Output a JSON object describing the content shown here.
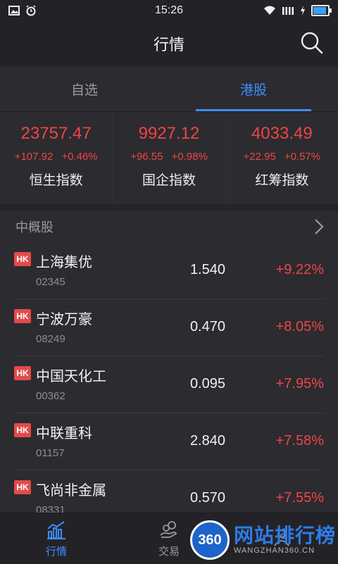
{
  "status": {
    "time": "15:26"
  },
  "header": {
    "title": "行情"
  },
  "tabs": [
    {
      "label": "自选",
      "active": false
    },
    {
      "label": "港股",
      "active": true
    }
  ],
  "indices": [
    {
      "value": "23757.47",
      "change": "+107.92",
      "pct": "+0.46%",
      "name": "恒生指数"
    },
    {
      "value": "9927.12",
      "change": "+96.55",
      "pct": "+0.98%",
      "name": "国企指数"
    },
    {
      "value": "4033.49",
      "change": "+22.95",
      "pct": "+0.57%",
      "name": "红筹指数"
    }
  ],
  "section": {
    "title": "中概股"
  },
  "stocks": [
    {
      "market": "HK",
      "name": "上海集优",
      "code": "02345",
      "price": "1.540",
      "pct": "+9.22%"
    },
    {
      "market": "HK",
      "name": "宁波万豪",
      "code": "08249",
      "price": "0.470",
      "pct": "+8.05%"
    },
    {
      "market": "HK",
      "name": "中国天化工",
      "code": "00362",
      "price": "0.095",
      "pct": "+7.95%"
    },
    {
      "market": "HK",
      "name": "中联重科",
      "code": "01157",
      "price": "2.840",
      "pct": "+7.58%"
    },
    {
      "market": "HK",
      "name": "飞尚非金属",
      "code": "08331",
      "price": "0.570",
      "pct": "+7.55%"
    }
  ],
  "bottom_nav": [
    {
      "label": "行情",
      "icon": "chart-icon",
      "active": true
    },
    {
      "label": "交易",
      "icon": "coins-icon",
      "active": false
    },
    {
      "label": "",
      "icon": "user-icon",
      "active": false
    }
  ],
  "watermark": {
    "badge": "360",
    "title": "网站排行榜",
    "sub": "WANGZHAN360.CN"
  },
  "colors": {
    "accent": "#3f8cff",
    "up": "#f04545",
    "hk_badge": "#e34a4a"
  }
}
